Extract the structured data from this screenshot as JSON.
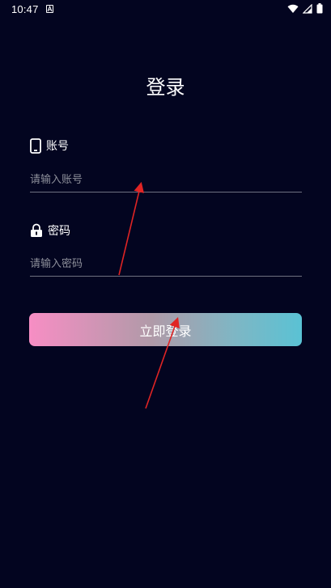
{
  "status_bar": {
    "time": "10:47"
  },
  "page": {
    "title": "登录"
  },
  "account": {
    "label": "账号",
    "placeholder": "请输入账号"
  },
  "password": {
    "label": "密码",
    "placeholder": "请输入密码"
  },
  "login_button": {
    "label": "立即登录"
  },
  "colors": {
    "background": "#030520",
    "button_gradient_start": "#f78ec4",
    "button_gradient_end": "#5ac2d4",
    "annotation_arrow": "#e02424"
  }
}
